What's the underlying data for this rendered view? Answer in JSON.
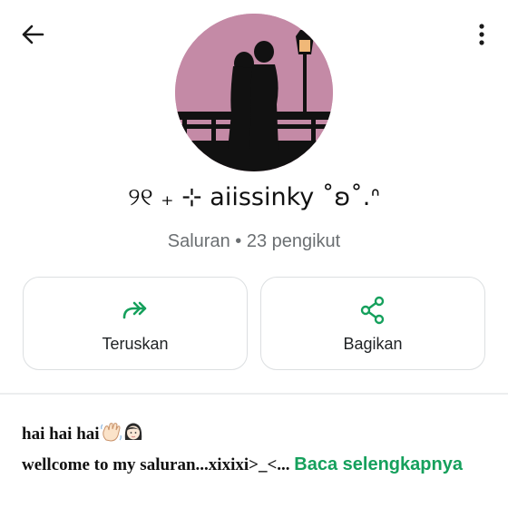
{
  "header": {
    "back_icon": "arrow-back-icon",
    "menu_icon": "more-vertical-icon"
  },
  "channel": {
    "avatar_icon": "couple-silhouette-avatar",
    "name": "୨୧ ₊ ⊹ aiissinky ˚ʚ˚.ᐢ",
    "meta": "Saluran • 23 pengikut"
  },
  "actions": [
    {
      "label": "Teruskan",
      "icon": "forward-icon"
    },
    {
      "label": "Bagikan",
      "icon": "share-icon"
    }
  ],
  "description": {
    "line1": "hai hai hai",
    "line1_emojis": [
      "waving-hand-emoji",
      "girl-emoji"
    ],
    "line2": "wellcome to my saluran...xixixi>_<... ",
    "read_more": "Baca selengkapnya"
  },
  "colors": {
    "accent": "#15a05c",
    "avatar_bg": "#c48aa6",
    "muted_text": "#6b6f72",
    "border": "#dcdfe1"
  }
}
